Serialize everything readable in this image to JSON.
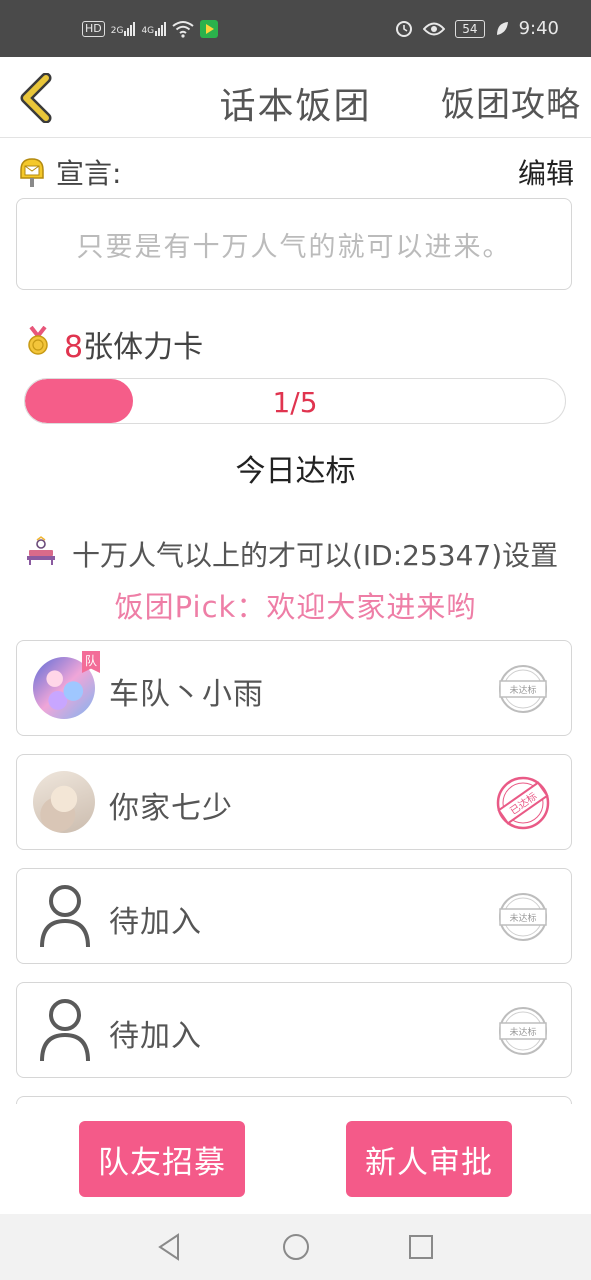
{
  "status_bar": {
    "hd": "HD",
    "net1": "2G",
    "net2": "4G",
    "battery": "54",
    "time": "9:40"
  },
  "header": {
    "title": "话本饭团",
    "guide_link": "饭团攻略"
  },
  "declaration": {
    "label": "宣言:",
    "edit_label": "编辑",
    "text": "只要是有十万人气的就可以进来。"
  },
  "stamina": {
    "count": "8",
    "unit_label": "张体力卡",
    "progress_label": "1/5",
    "progress_fraction": 0.2,
    "status": "今日达标"
  },
  "requirement": {
    "text": "十万人气以上的才可以(ID:25347)设置"
  },
  "pick": {
    "text": "饭团Pick：欢迎大家进来哟"
  },
  "members": [
    {
      "name": "车队丶小雨",
      "captain_tag": "队",
      "stamp": "未达标",
      "avatar": "anime-avatar"
    },
    {
      "name": "你家七少",
      "stamp": "已达标",
      "avatar": "photo-avatar"
    },
    {
      "name": "待加入",
      "stamp": "未达标",
      "avatar": "person-placeholder-icon"
    },
    {
      "name": "待加入",
      "stamp": "未达标",
      "avatar": "person-placeholder-icon"
    }
  ],
  "actions": {
    "recruit_label": "队友招募",
    "approve_label": "新人审批"
  },
  "colors": {
    "accent_pink": "#f45a89",
    "highlight_red": "#e0344f",
    "pick_pink": "#ee7ea6",
    "back_arrow": "#e9c63a"
  }
}
